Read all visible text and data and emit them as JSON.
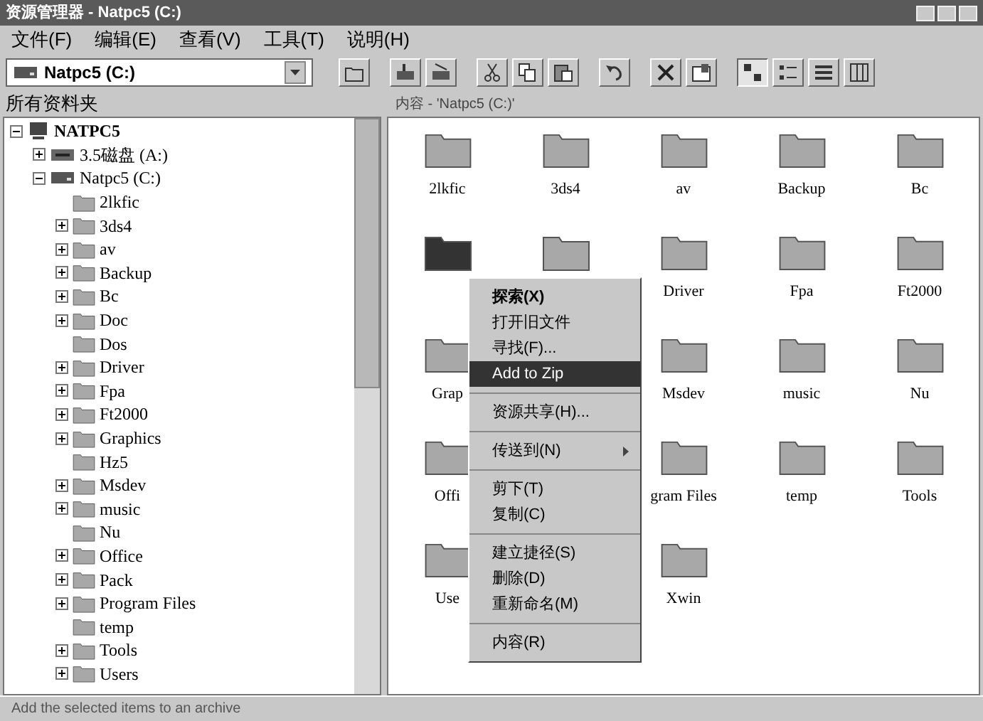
{
  "window": {
    "title": "资源管理器 - Natpc5 (C:)"
  },
  "menu": [
    "文件(F)",
    "编辑(E)",
    "查看(V)",
    "工具(T)",
    "说明(H)"
  ],
  "address": {
    "value": "Natpc5 (C:)"
  },
  "views": [
    {
      "kind": "large",
      "selected": true
    },
    {
      "kind": "small",
      "selected": false
    },
    {
      "kind": "list",
      "selected": false
    },
    {
      "kind": "details",
      "selected": false
    }
  ],
  "left_header": "所有资料夹",
  "right_header": "内容 - 'Natpc5 (C:)'",
  "tree": [
    {
      "label": "NATPC5",
      "kind": "computer",
      "expandable": true,
      "expanded": true,
      "children": [
        {
          "label": "3.5磁盘 (A:)",
          "kind": "floppy",
          "expandable": true,
          "expanded": false
        },
        {
          "label": "Natpc5 (C:)",
          "kind": "drive",
          "expandable": true,
          "expanded": true,
          "children": [
            {
              "label": "2lkfic",
              "kind": "folder",
              "expandable": false,
              "expanded": false
            },
            {
              "label": "3ds4",
              "kind": "folder",
              "expandable": true,
              "expanded": false
            },
            {
              "label": "av",
              "kind": "folder",
              "expandable": true,
              "expanded": false
            },
            {
              "label": "Backup",
              "kind": "folder",
              "expandable": true,
              "expanded": false
            },
            {
              "label": "Bc",
              "kind": "folder",
              "expandable": true,
              "expanded": false
            },
            {
              "label": "Doc",
              "kind": "folder",
              "expandable": true,
              "expanded": false
            },
            {
              "label": "Dos",
              "kind": "folder",
              "expandable": false,
              "expanded": false
            },
            {
              "label": "Driver",
              "kind": "folder",
              "expandable": true,
              "expanded": false
            },
            {
              "label": "Fpa",
              "kind": "folder",
              "expandable": true,
              "expanded": false
            },
            {
              "label": "Ft2000",
              "kind": "folder",
              "expandable": true,
              "expanded": false
            },
            {
              "label": "Graphics",
              "kind": "folder",
              "expandable": true,
              "expanded": false
            },
            {
              "label": "Hz5",
              "kind": "folder",
              "expandable": false,
              "expanded": false
            },
            {
              "label": "Msdev",
              "kind": "folder",
              "expandable": true,
              "expanded": false
            },
            {
              "label": "music",
              "kind": "folder",
              "expandable": true,
              "expanded": false
            },
            {
              "label": "Nu",
              "kind": "folder",
              "expandable": false,
              "expanded": false
            },
            {
              "label": "Office",
              "kind": "folder",
              "expandable": true,
              "expanded": false
            },
            {
              "label": "Pack",
              "kind": "folder",
              "expandable": true,
              "expanded": false
            },
            {
              "label": "Program Files",
              "kind": "folder",
              "expandable": true,
              "expanded": false
            },
            {
              "label": "temp",
              "kind": "folder",
              "expandable": false,
              "expanded": false
            },
            {
              "label": "Tools",
              "kind": "folder",
              "expandable": true,
              "expanded": false
            },
            {
              "label": "Users",
              "kind": "folder",
              "expandable": true,
              "expanded": false
            }
          ]
        }
      ]
    }
  ],
  "files": [
    {
      "label": "2lkfic",
      "selected": false
    },
    {
      "label": "3ds4",
      "selected": false
    },
    {
      "label": "av",
      "selected": false
    },
    {
      "label": "Backup",
      "selected": false
    },
    {
      "label": "Bc",
      "selected": false
    },
    {
      "selected": true
    },
    {
      "selected": false
    },
    {
      "label": "Driver",
      "selected": false
    },
    {
      "label": "Fpa",
      "selected": false
    },
    {
      "label": "Ft2000",
      "selected": false
    },
    {
      "label": "Grap",
      "selected": false
    },
    {
      "label": "Msdev",
      "selected": false
    },
    {
      "label": "music",
      "selected": false
    },
    {
      "label": "Nu",
      "selected": false
    },
    {
      "label": "Offi",
      "selected": false
    },
    {
      "label": "gram Files",
      "selected": false
    },
    {
      "label": "temp",
      "selected": false
    },
    {
      "label": "Tools",
      "selected": false
    },
    {
      "label": "Use",
      "selected": false
    },
    {
      "label": "Xwin",
      "selected": false
    }
  ],
  "context_menu": [
    {
      "group": [
        {
          "label": "探索(X)",
          "bold": true,
          "selected": false,
          "submenu": false
        },
        {
          "label": "打开旧文件",
          "bold": false,
          "selected": false,
          "submenu": false
        },
        {
          "label": "寻找(F)...",
          "bold": false,
          "selected": false,
          "submenu": false
        },
        {
          "label": "Add to Zip",
          "bold": false,
          "selected": true,
          "submenu": false
        }
      ]
    },
    {
      "group": [
        {
          "label": "资源共享(H)...",
          "bold": false,
          "selected": false,
          "submenu": false
        }
      ]
    },
    {
      "group": [
        {
          "label": "传送到(N)",
          "bold": false,
          "selected": false,
          "submenu": true
        }
      ]
    },
    {
      "group": [
        {
          "label": "剪下(T)",
          "bold": false,
          "selected": false,
          "submenu": false
        },
        {
          "label": "复制(C)",
          "bold": false,
          "selected": false,
          "submenu": false
        }
      ]
    },
    {
      "group": [
        {
          "label": "建立捷径(S)",
          "bold": false,
          "selected": false,
          "submenu": false
        },
        {
          "label": "删除(D)",
          "bold": false,
          "selected": false,
          "submenu": false
        },
        {
          "label": "重新命名(M)",
          "bold": false,
          "selected": false,
          "submenu": false
        }
      ]
    },
    {
      "group": [
        {
          "label": "内容(R)",
          "bold": false,
          "selected": false,
          "submenu": false
        }
      ]
    }
  ],
  "status_bar": "Add the selected items to an archive"
}
